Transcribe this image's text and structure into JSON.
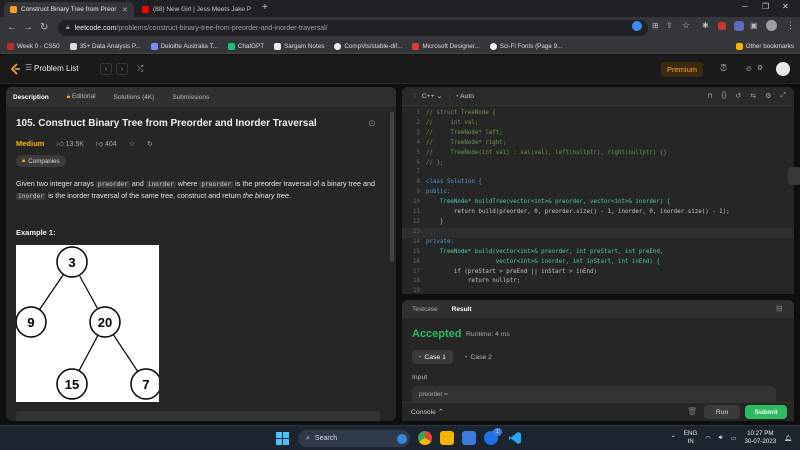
{
  "browser": {
    "tabs": [
      {
        "title": "Construct Binary Tree from Preor",
        "active": true,
        "favicon_color": "#ffa116"
      },
      {
        "title": "(88) New Girl | Jess Meets Jake P",
        "active": false,
        "favicon_color": "#ff0000"
      }
    ],
    "new_tab": "+",
    "url_domain": "leetcode.com",
    "url_path": "/problems/construct-binary-tree-from-preorder-and-inorder-traversal/",
    "bookmarks": [
      {
        "label": "Week 0 - CS50",
        "color": "#c62828"
      },
      {
        "label": "35+ Data Analysis P...",
        "color": "#dddddd"
      },
      {
        "label": "Deloitte Australia T...",
        "color": "#7b8cff"
      },
      {
        "label": "ChatGPT",
        "color": "#19c37d"
      },
      {
        "label": "Sargam Notes",
        "color": "#eeeeee"
      },
      {
        "label": "CompVis/stable-dif...",
        "color": "#eeeeee"
      },
      {
        "label": "Microsoft Designer...",
        "color": "#e53935"
      },
      {
        "label": "Sci-Fi Fonts (Page 9...",
        "color": "#eeeeee"
      }
    ],
    "other_bookmarks": "Other bookmarks"
  },
  "nav": {
    "problem_list": "Problem List",
    "premium": "Premium",
    "streak": "0"
  },
  "problem": {
    "tabs": [
      "Description",
      "Editorial",
      "Solutions (4K)",
      "Submissions"
    ],
    "title": "105. Construct Binary Tree from Preorder and Inorder Traversal",
    "difficulty": "Medium",
    "likes": "13.5K",
    "dislikes": "404",
    "companies": "Companies",
    "desc_1": "Given two integer arrays ",
    "code_preorder": "preorder",
    "desc_2": " and ",
    "code_inorder": "inorder",
    "desc_3": " where ",
    "desc_4": " is the preorder traversal of a binary tree and ",
    "desc_5": " is the inorder traversal of the same tree, construct and return ",
    "desc_em": "the binary tree",
    "desc_6": ".",
    "example_title": "Example 1:",
    "tree_nodes": [
      "3",
      "9",
      "20",
      "15",
      "7"
    ]
  },
  "editor": {
    "language": "C++",
    "mode": "Auto",
    "lines": [
      {
        "n": "1",
        "t": "// struct TreeNode {",
        "c": "cm"
      },
      {
        "n": "2",
        "t": "//     int val;",
        "c": "cm"
      },
      {
        "n": "3",
        "t": "//     TreeNode* left;",
        "c": "cm"
      },
      {
        "n": "4",
        "t": "//     TreeNode* right;",
        "c": "cm"
      },
      {
        "n": "5",
        "t": "//     TreeNode(int val) : val(val), left(nullptr), right(nullptr) {}",
        "c": "cm"
      },
      {
        "n": "6",
        "t": "// };",
        "c": "cm"
      },
      {
        "n": "7",
        "t": "",
        "c": "ctext"
      },
      {
        "n": "8",
        "t": "class Solution {",
        "c": "kw"
      },
      {
        "n": "9",
        "t": "public:",
        "c": "kw"
      },
      {
        "n": "10",
        "t": "    TreeNode* buildTree(vector<int>& preorder, vector<int>& inorder) {",
        "c": "ty"
      },
      {
        "n": "11",
        "t": "        return build(preorder, 0, preorder.size() - 1, inorder, 0, inorder.size() - 1);",
        "c": "ctext"
      },
      {
        "n": "12",
        "t": "    }",
        "c": "ctext"
      },
      {
        "n": "13",
        "t": "",
        "c": "ctext"
      },
      {
        "n": "14",
        "t": "private:",
        "c": "kw"
      },
      {
        "n": "15",
        "t": "    TreeNode* build(vector<int>& preorder, int preStart, int preEnd,",
        "c": "ty"
      },
      {
        "n": "16",
        "t": "                    vector<int>& inorder, int inStart, int inEnd) {",
        "c": "ty"
      },
      {
        "n": "17",
        "t": "        if (preStart > preEnd || inStart > inEnd)",
        "c": "ctext"
      },
      {
        "n": "18",
        "t": "            return nullptr;",
        "c": "ctext"
      },
      {
        "n": "19",
        "t": "",
        "c": "ctext"
      }
    ],
    "current_line": "13"
  },
  "result": {
    "tabs": [
      "Testcase",
      "Result"
    ],
    "status": "Accepted",
    "runtime": "Runtime: 4 ms",
    "case_1": "Case 1",
    "case_2": "Case 2",
    "input_label": "Input",
    "input_value": "preorder =",
    "console": "Console",
    "run": "Run",
    "submit": "Submit"
  },
  "taskbar": {
    "search": "Search",
    "lang_1": "ENG",
    "lang_2": "IN",
    "time": "10:27 PM",
    "date": "30-07-2023",
    "badge": "1"
  },
  "colors": {
    "accent": "#ffa116",
    "accepted": "#2cbb5d",
    "medium": "#ffb800"
  }
}
